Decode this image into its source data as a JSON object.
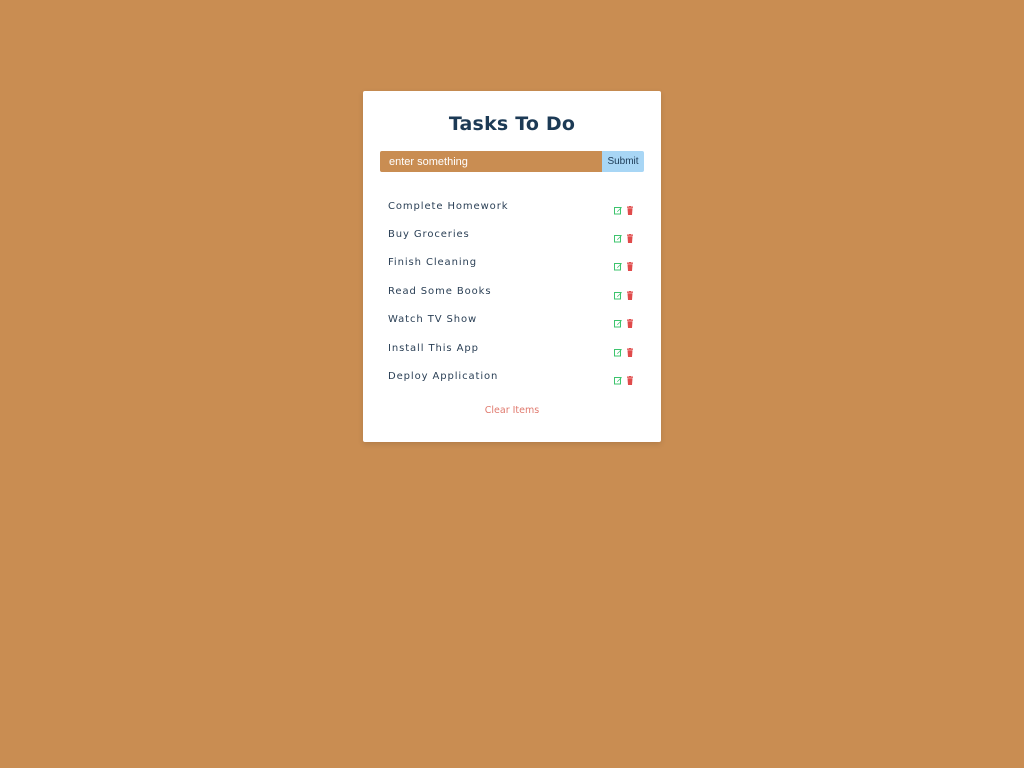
{
  "app": {
    "title": "Tasks To Do"
  },
  "form": {
    "placeholder": "enter something",
    "submit_label": "Submit"
  },
  "tasks": [
    {
      "label": "Complete Homework"
    },
    {
      "label": "Buy Groceries"
    },
    {
      "label": "Finish Cleaning"
    },
    {
      "label": "Read Some Books"
    },
    {
      "label": "Watch TV Show"
    },
    {
      "label": "Install This App"
    },
    {
      "label": "Deploy Application"
    }
  ],
  "actions": {
    "clear_label": "Clear Items",
    "edit_icon": "edit-icon",
    "delete_icon": "trash-icon"
  },
  "colors": {
    "background": "#c98d52",
    "card": "#ffffff",
    "title": "#1c3a55",
    "input": "#c98d52",
    "submit": "#a8d6f5",
    "edit": "#3cc46d",
    "delete": "#e04b4b",
    "clear": "#e07a6e"
  }
}
